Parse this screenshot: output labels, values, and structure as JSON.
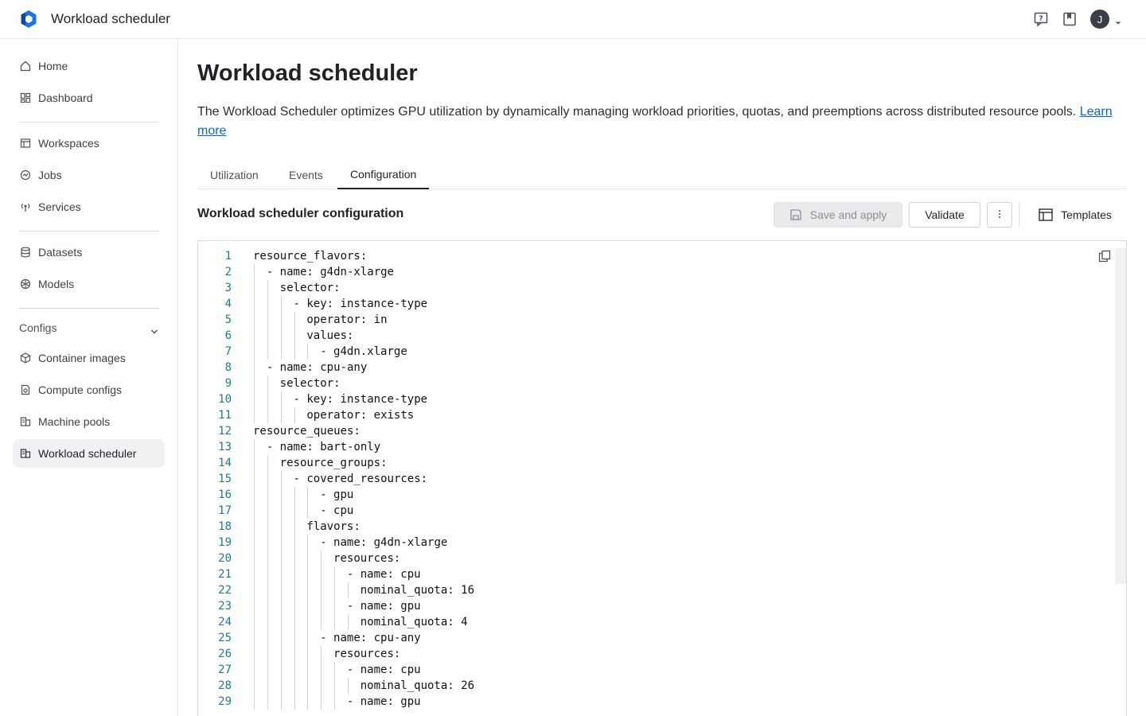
{
  "app": {
    "title": "Workload scheduler",
    "user_initial": "J"
  },
  "sidebar": {
    "items": [
      {
        "label": "Home",
        "icon": "home-icon"
      },
      {
        "label": "Dashboard",
        "icon": "dashboard-icon"
      },
      {
        "label": "Workspaces",
        "icon": "workspaces-icon"
      },
      {
        "label": "Jobs",
        "icon": "jobs-icon"
      },
      {
        "label": "Services",
        "icon": "services-icon"
      },
      {
        "label": "Datasets",
        "icon": "datasets-icon"
      },
      {
        "label": "Models",
        "icon": "models-icon"
      }
    ],
    "configs_label": "Configs",
    "configs_items": [
      {
        "label": "Container images",
        "icon": "container-icon"
      },
      {
        "label": "Compute configs",
        "icon": "compute-icon"
      },
      {
        "label": "Machine pools",
        "icon": "machine-pools-icon"
      },
      {
        "label": "Workload scheduler",
        "icon": "scheduler-icon",
        "active": true
      }
    ]
  },
  "page": {
    "title": "Workload scheduler",
    "description": "The Workload Scheduler optimizes GPU utilization by dynamically managing workload priorities, quotas, and preemptions across distributed resource pools.",
    "learn_more": "Learn more"
  },
  "tabs": [
    {
      "label": "Utilization",
      "active": false
    },
    {
      "label": "Events",
      "active": false
    },
    {
      "label": "Configuration",
      "active": true
    }
  ],
  "config": {
    "title": "Workload scheduler configuration",
    "save_label": "Save and apply",
    "validate_label": "Validate",
    "templates_label": "Templates"
  },
  "colors": {
    "accent_link": "#0b66c3",
    "line_number": "#237893",
    "active_nav_bg": "#f0f1f3",
    "logo_blue": "#1a73e8"
  },
  "editor": {
    "lines": [
      {
        "n": "1",
        "indent": 0,
        "text": "resource_flavors:"
      },
      {
        "n": "2",
        "indent": 1,
        "text": "- name: g4dn-xlarge"
      },
      {
        "n": "3",
        "indent": 2,
        "text": "selector:"
      },
      {
        "n": "4",
        "indent": 3,
        "text": "- key: instance-type"
      },
      {
        "n": "5",
        "indent": 4,
        "text": "operator: in"
      },
      {
        "n": "6",
        "indent": 4,
        "text": "values:"
      },
      {
        "n": "7",
        "indent": 5,
        "text": "- g4dn.xlarge"
      },
      {
        "n": "8",
        "indent": 1,
        "text": "- name: cpu-any"
      },
      {
        "n": "9",
        "indent": 2,
        "text": "selector:"
      },
      {
        "n": "10",
        "indent": 3,
        "text": "- key: instance-type"
      },
      {
        "n": "11",
        "indent": 4,
        "text": "operator: exists"
      },
      {
        "n": "12",
        "indent": 0,
        "text": "resource_queues:"
      },
      {
        "n": "13",
        "indent": 1,
        "text": "- name: bart-only"
      },
      {
        "n": "14",
        "indent": 2,
        "text": "resource_groups:"
      },
      {
        "n": "15",
        "indent": 3,
        "text": "- covered_resources:"
      },
      {
        "n": "16",
        "indent": 5,
        "text": "- gpu"
      },
      {
        "n": "17",
        "indent": 5,
        "text": "- cpu"
      },
      {
        "n": "18",
        "indent": 4,
        "text": "flavors:"
      },
      {
        "n": "19",
        "indent": 5,
        "text": "- name: g4dn-xlarge"
      },
      {
        "n": "20",
        "indent": 6,
        "text": "resources:"
      },
      {
        "n": "21",
        "indent": 7,
        "text": "- name: cpu"
      },
      {
        "n": "22",
        "indent": 8,
        "text": "nominal_quota: 16"
      },
      {
        "n": "23",
        "indent": 7,
        "text": "- name: gpu"
      },
      {
        "n": "24",
        "indent": 8,
        "text": "nominal_quota: 4"
      },
      {
        "n": "25",
        "indent": 5,
        "text": "- name: cpu-any"
      },
      {
        "n": "26",
        "indent": 6,
        "text": "resources:"
      },
      {
        "n": "27",
        "indent": 7,
        "text": "- name: cpu"
      },
      {
        "n": "28",
        "indent": 8,
        "text": "nominal_quota: 26"
      },
      {
        "n": "29",
        "indent": 7,
        "text": "- name: gpu"
      }
    ]
  }
}
